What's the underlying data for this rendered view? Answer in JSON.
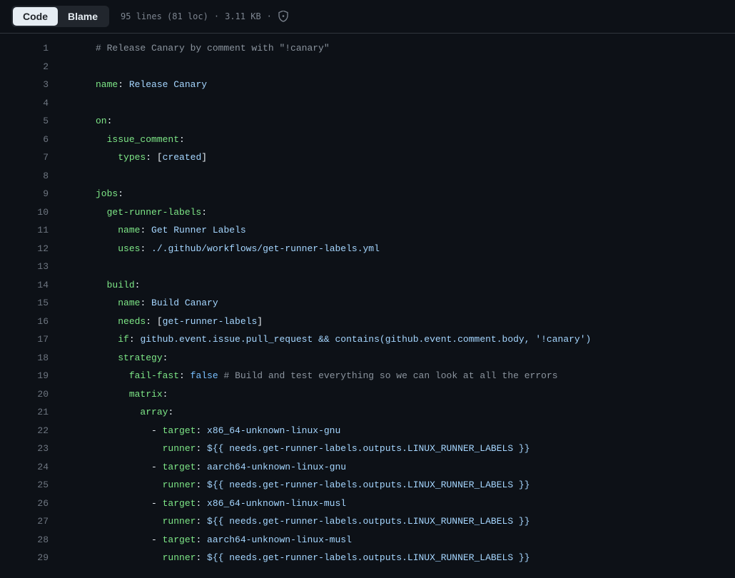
{
  "toolbar": {
    "tabs": {
      "code": "Code",
      "blame": "Blame"
    },
    "file_info": {
      "lines": "95 lines (81 loc)",
      "size": "3.11 KB"
    }
  },
  "code": {
    "start_line": 1,
    "lines": [
      [
        {
          "t": "comment",
          "v": "# Release Canary by comment with \"!canary\""
        }
      ],
      [],
      [
        {
          "t": "key",
          "v": "name"
        },
        {
          "t": "punct",
          "v": ": "
        },
        {
          "t": "string",
          "v": "Release Canary"
        }
      ],
      [],
      [
        {
          "t": "key",
          "v": "on"
        },
        {
          "t": "punct",
          "v": ":"
        }
      ],
      [
        {
          "t": "plain",
          "v": "  "
        },
        {
          "t": "key",
          "v": "issue_comment"
        },
        {
          "t": "punct",
          "v": ":"
        }
      ],
      [
        {
          "t": "plain",
          "v": "    "
        },
        {
          "t": "key",
          "v": "types"
        },
        {
          "t": "punct",
          "v": ": ["
        },
        {
          "t": "string",
          "v": "created"
        },
        {
          "t": "punct",
          "v": "]"
        }
      ],
      [],
      [
        {
          "t": "key",
          "v": "jobs"
        },
        {
          "t": "punct",
          "v": ":"
        }
      ],
      [
        {
          "t": "plain",
          "v": "  "
        },
        {
          "t": "key",
          "v": "get-runner-labels"
        },
        {
          "t": "punct",
          "v": ":"
        }
      ],
      [
        {
          "t": "plain",
          "v": "    "
        },
        {
          "t": "key",
          "v": "name"
        },
        {
          "t": "punct",
          "v": ": "
        },
        {
          "t": "string",
          "v": "Get Runner Labels"
        }
      ],
      [
        {
          "t": "plain",
          "v": "    "
        },
        {
          "t": "key",
          "v": "uses"
        },
        {
          "t": "punct",
          "v": ": "
        },
        {
          "t": "string",
          "v": "./.github/workflows/get-runner-labels.yml"
        }
      ],
      [],
      [
        {
          "t": "plain",
          "v": "  "
        },
        {
          "t": "key",
          "v": "build"
        },
        {
          "t": "punct",
          "v": ":"
        }
      ],
      [
        {
          "t": "plain",
          "v": "    "
        },
        {
          "t": "key",
          "v": "name"
        },
        {
          "t": "punct",
          "v": ": "
        },
        {
          "t": "string",
          "v": "Build Canary"
        }
      ],
      [
        {
          "t": "plain",
          "v": "    "
        },
        {
          "t": "key",
          "v": "needs"
        },
        {
          "t": "punct",
          "v": ": ["
        },
        {
          "t": "string",
          "v": "get-runner-labels"
        },
        {
          "t": "punct",
          "v": "]"
        }
      ],
      [
        {
          "t": "plain",
          "v": "    "
        },
        {
          "t": "key",
          "v": "if"
        },
        {
          "t": "punct",
          "v": ": "
        },
        {
          "t": "string",
          "v": "github.event.issue.pull_request && contains(github.event.comment.body, '!canary')"
        }
      ],
      [
        {
          "t": "plain",
          "v": "    "
        },
        {
          "t": "key",
          "v": "strategy"
        },
        {
          "t": "punct",
          "v": ":"
        }
      ],
      [
        {
          "t": "plain",
          "v": "      "
        },
        {
          "t": "key",
          "v": "fail-fast"
        },
        {
          "t": "punct",
          "v": ": "
        },
        {
          "t": "const",
          "v": "false"
        },
        {
          "t": "plain",
          "v": " "
        },
        {
          "t": "comment",
          "v": "# Build and test everything so we can look at all the errors"
        }
      ],
      [
        {
          "t": "plain",
          "v": "      "
        },
        {
          "t": "key",
          "v": "matrix"
        },
        {
          "t": "punct",
          "v": ":"
        }
      ],
      [
        {
          "t": "plain",
          "v": "        "
        },
        {
          "t": "key",
          "v": "array"
        },
        {
          "t": "punct",
          "v": ":"
        }
      ],
      [
        {
          "t": "plain",
          "v": "          "
        },
        {
          "t": "dash",
          "v": "- "
        },
        {
          "t": "key",
          "v": "target"
        },
        {
          "t": "punct",
          "v": ": "
        },
        {
          "t": "string",
          "v": "x86_64-unknown-linux-gnu"
        }
      ],
      [
        {
          "t": "plain",
          "v": "            "
        },
        {
          "t": "key",
          "v": "runner"
        },
        {
          "t": "punct",
          "v": ": "
        },
        {
          "t": "string",
          "v": "${{ needs.get-runner-labels.outputs.LINUX_RUNNER_LABELS }}"
        }
      ],
      [
        {
          "t": "plain",
          "v": "          "
        },
        {
          "t": "dash",
          "v": "- "
        },
        {
          "t": "key",
          "v": "target"
        },
        {
          "t": "punct",
          "v": ": "
        },
        {
          "t": "string",
          "v": "aarch64-unknown-linux-gnu"
        }
      ],
      [
        {
          "t": "plain",
          "v": "            "
        },
        {
          "t": "key",
          "v": "runner"
        },
        {
          "t": "punct",
          "v": ": "
        },
        {
          "t": "string",
          "v": "${{ needs.get-runner-labels.outputs.LINUX_RUNNER_LABELS }}"
        }
      ],
      [
        {
          "t": "plain",
          "v": "          "
        },
        {
          "t": "dash",
          "v": "- "
        },
        {
          "t": "key",
          "v": "target"
        },
        {
          "t": "punct",
          "v": ": "
        },
        {
          "t": "string",
          "v": "x86_64-unknown-linux-musl"
        }
      ],
      [
        {
          "t": "plain",
          "v": "            "
        },
        {
          "t": "key",
          "v": "runner"
        },
        {
          "t": "punct",
          "v": ": "
        },
        {
          "t": "string",
          "v": "${{ needs.get-runner-labels.outputs.LINUX_RUNNER_LABELS }}"
        }
      ],
      [
        {
          "t": "plain",
          "v": "          "
        },
        {
          "t": "dash",
          "v": "- "
        },
        {
          "t": "key",
          "v": "target"
        },
        {
          "t": "punct",
          "v": ": "
        },
        {
          "t": "string",
          "v": "aarch64-unknown-linux-musl"
        }
      ],
      [
        {
          "t": "plain",
          "v": "            "
        },
        {
          "t": "key",
          "v": "runner"
        },
        {
          "t": "punct",
          "v": ": "
        },
        {
          "t": "string",
          "v": "${{ needs.get-runner-labels.outputs.LINUX_RUNNER_LABELS }}"
        }
      ]
    ]
  }
}
